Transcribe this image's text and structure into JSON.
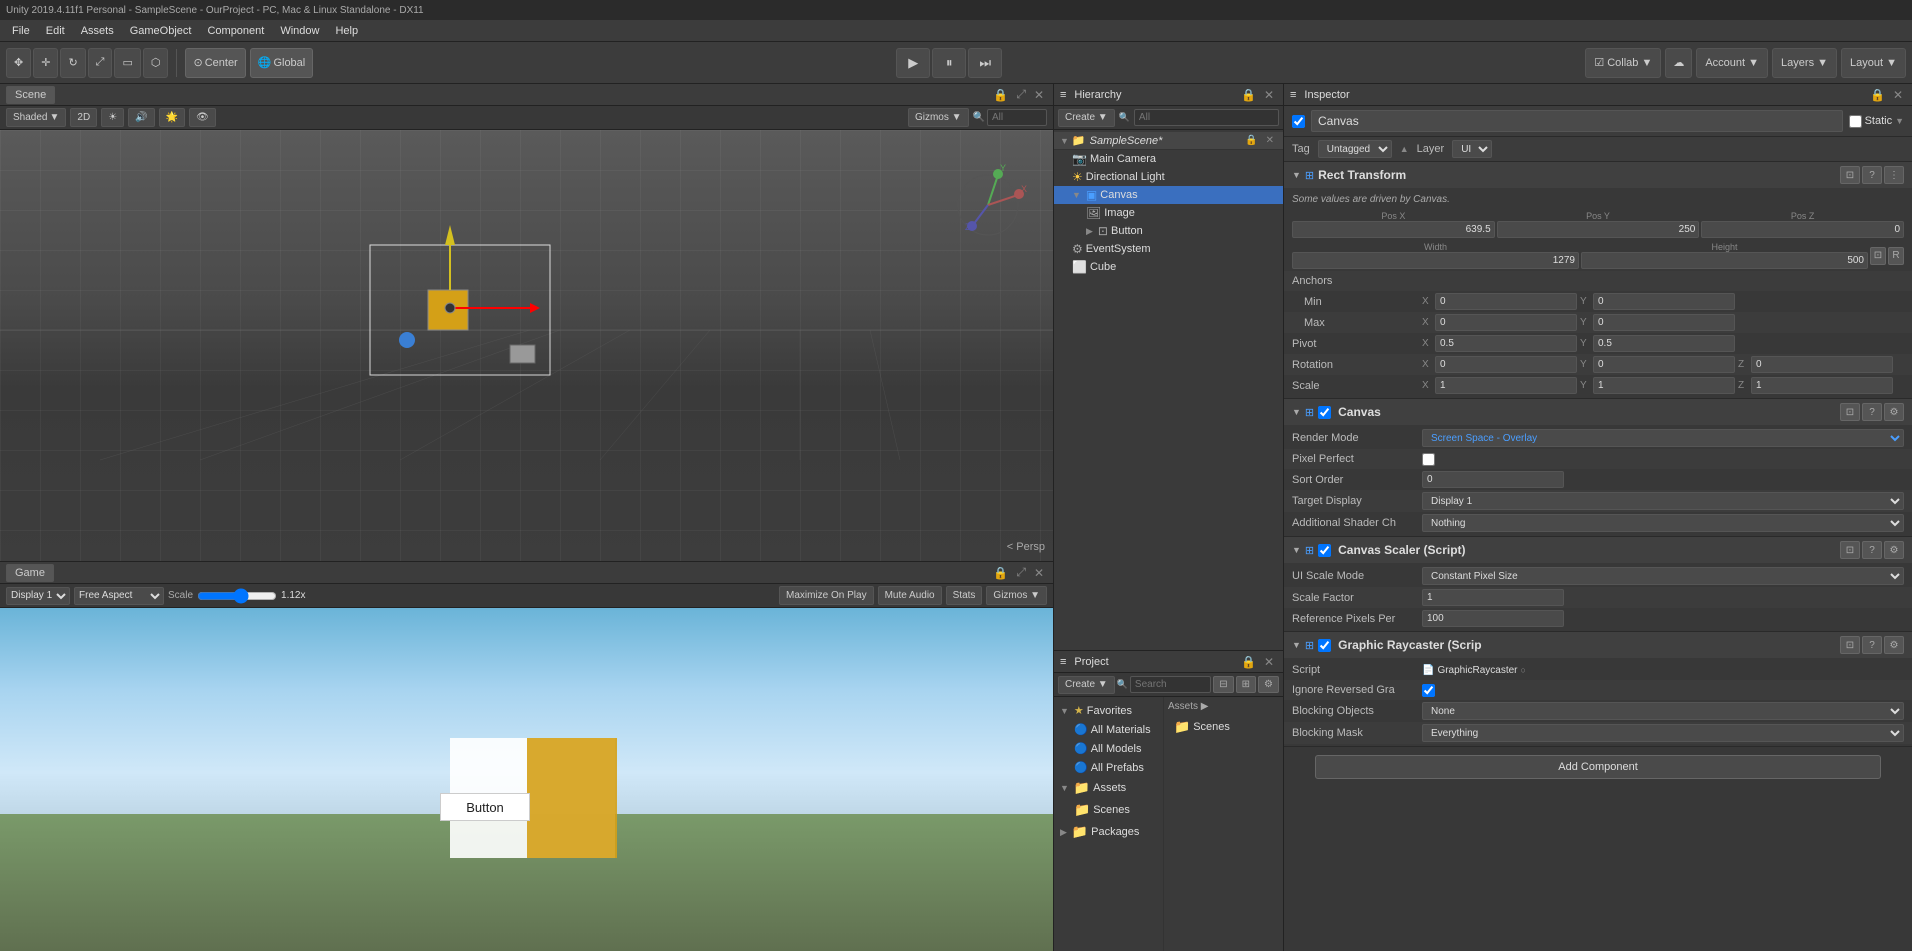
{
  "titlebar": {
    "text": "Unity 2019.4.11f1 Personal - SampleScene - OurProject - PC, Mac & Linux Standalone - DX11"
  },
  "menubar": {
    "items": [
      "File",
      "Edit",
      "Assets",
      "GameObject",
      "Component",
      "Window",
      "Help"
    ]
  },
  "toolbar": {
    "transform_tools": [
      "⊕",
      "✥",
      "⟳",
      "⤢",
      "▭"
    ],
    "pivot_label": "Center",
    "space_label": "Global",
    "play_tooltip": "Play",
    "pause_tooltip": "Pause",
    "step_tooltip": "Step",
    "collab_label": "Collab ▼",
    "cloud_label": "☁",
    "account_label": "Account ▼",
    "layers_label": "Layers ▼",
    "layout_label": "Layout ▼"
  },
  "scene_panel": {
    "tab_label": "Scene",
    "shaded_label": "Shaded",
    "mode_2d": "2D",
    "gizmos_label": "Gizmos ▼",
    "search_placeholder": "All",
    "persp_label": "< Persp"
  },
  "game_panel": {
    "tab_label": "Game",
    "display_label": "Display 1",
    "aspect_label": "Free Aspect",
    "scale_label": "Scale",
    "scale_value": "1.12x",
    "maximize_label": "Maximize On Play",
    "mute_label": "Mute Audio",
    "stats_label": "Stats",
    "gizmos_label": "Gizmos ▼",
    "button_label": "Button"
  },
  "hierarchy": {
    "tab_label": "Hierarchy",
    "create_label": "Create ▼",
    "search_placeholder": "All",
    "scene_name": "SampleScene*",
    "items": [
      {
        "name": "Main Camera",
        "indent": 1,
        "icon": "camera"
      },
      {
        "name": "Directional Light",
        "indent": 1,
        "icon": "light"
      },
      {
        "name": "Canvas",
        "indent": 1,
        "icon": "canvas",
        "selected": true,
        "expanded": true
      },
      {
        "name": "Image",
        "indent": 2,
        "icon": "image"
      },
      {
        "name": "Button",
        "indent": 2,
        "icon": "button"
      },
      {
        "name": "EventSystem",
        "indent": 1,
        "icon": "eventsystem"
      },
      {
        "name": "Cube",
        "indent": 1,
        "icon": "cube"
      }
    ]
  },
  "project": {
    "tab_label": "Project",
    "create_label": "Create ▼",
    "favorites": {
      "label": "Favorites",
      "items": [
        "All Materials",
        "All Models",
        "All Prefabs"
      ]
    },
    "assets": {
      "label": "Assets",
      "items": [
        "Scenes"
      ]
    },
    "packages": {
      "label": "Packages"
    },
    "right_panel": {
      "assets_label": "Assets ▶",
      "items": [
        "Scenes"
      ]
    }
  },
  "inspector": {
    "tab_label": "Inspector",
    "object_name": "Canvas",
    "static_label": "Static",
    "tag_label": "Tag",
    "tag_value": "Untagged",
    "layer_label": "Layer",
    "layer_value": "UI",
    "rect_transform": {
      "title": "Rect Transform",
      "warning": "Some values are driven by Canvas.",
      "pos_x": "639.5",
      "pos_y": "250",
      "pos_z": "0",
      "width": "1279",
      "height": "500",
      "anchors_label": "Anchors",
      "min_label": "Min",
      "min_x": "0",
      "min_y": "0",
      "max_label": "Max",
      "max_x": "0",
      "max_y": "0",
      "pivot_label": "Pivot",
      "pivot_x": "0.5",
      "pivot_y": "0.5",
      "rotation_label": "Rotation",
      "rot_x": "0",
      "rot_y": "0",
      "rot_z": "0",
      "scale_label": "Scale",
      "scale_x": "1",
      "scale_y": "1",
      "scale_z": "1"
    },
    "canvas_component": {
      "title": "Canvas",
      "enabled": true,
      "render_mode_label": "Render Mode",
      "render_mode_value": "Screen Space - Overlay",
      "pixel_perfect_label": "Pixel Perfect",
      "pixel_perfect_value": false,
      "sort_order_label": "Sort Order",
      "sort_order_value": "0",
      "target_display_label": "Target Display",
      "target_display_value": "Display 1",
      "additional_shader_label": "Additional Shader Ch",
      "additional_shader_value": "Nothing"
    },
    "canvas_scaler": {
      "title": "Canvas Scaler (Script)",
      "enabled": true,
      "ui_scale_mode_label": "UI Scale Mode",
      "ui_scale_mode_value": "Constant Pixel Size",
      "scale_factor_label": "Scale Factor",
      "scale_factor_value": "1",
      "reference_pixels_label": "Reference Pixels Per",
      "reference_pixels_value": "100"
    },
    "graphic_raycaster": {
      "title": "Graphic Raycaster (Scrip",
      "enabled": true,
      "script_label": "Script",
      "script_value": "GraphicRaycaster",
      "ignore_reversed_label": "Ignore Reversed Gra",
      "ignore_reversed_value": true,
      "blocking_objects_label": "Blocking Objects",
      "blocking_objects_value": "None",
      "blocking_mask_label": "Blocking Mask",
      "blocking_mask_value": "Everything"
    },
    "add_component_label": "Add Component"
  }
}
